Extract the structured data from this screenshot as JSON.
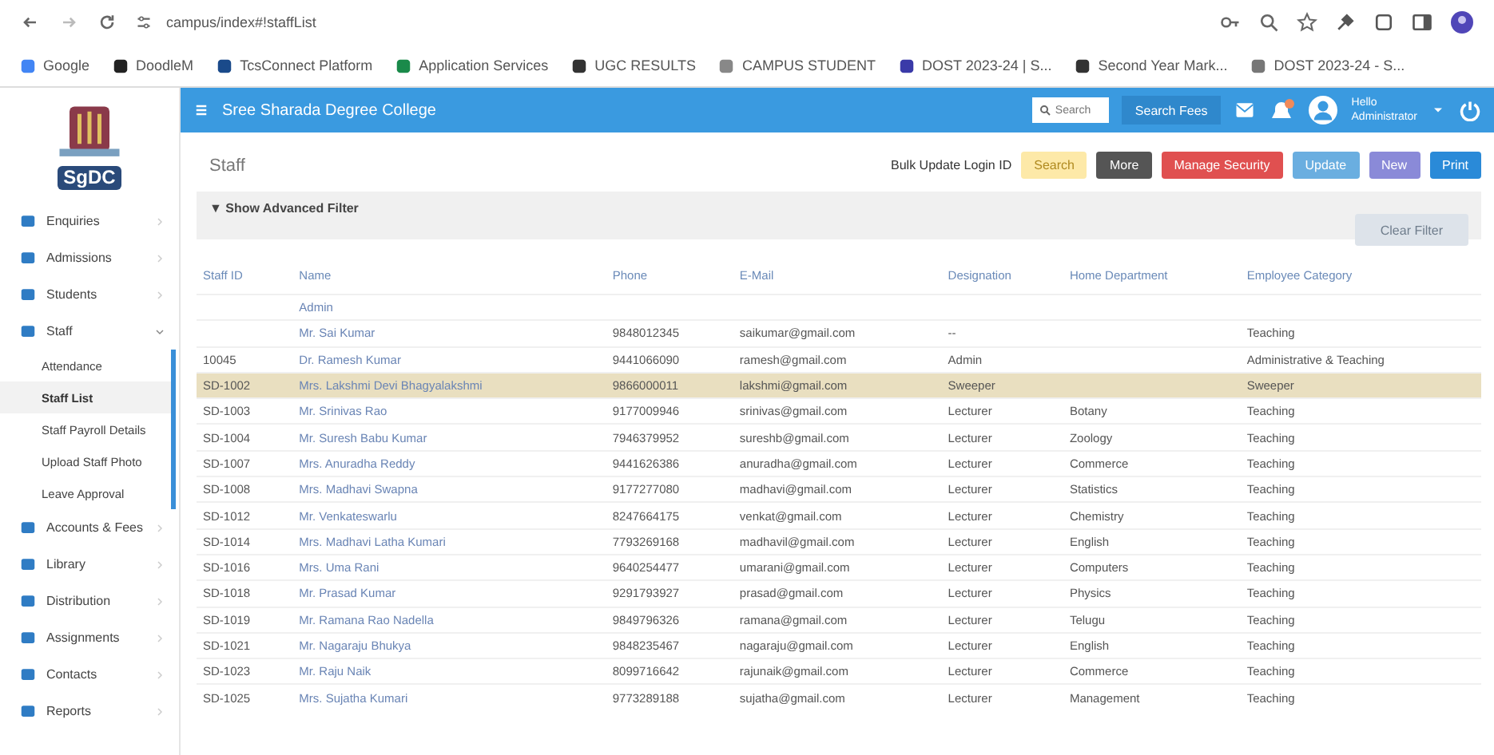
{
  "browser": {
    "url": "campus/index#!staffList",
    "bookmarks": [
      {
        "label": "Google"
      },
      {
        "label": "DoodleM"
      },
      {
        "label": "TcsConnect Platform"
      },
      {
        "label": "Application Services"
      },
      {
        "label": "UGC RESULTS"
      },
      {
        "label": "CAMPUS STUDENT"
      },
      {
        "label": "DOST 2023-24 | S..."
      },
      {
        "label": "Second Year Mark..."
      },
      {
        "label": "DOST 2023-24 - S..."
      }
    ]
  },
  "sidebar": {
    "logo_text": "SgDC",
    "items": [
      {
        "label": "Enquiries",
        "expanded": false,
        "selected": false
      },
      {
        "label": "Admissions",
        "expanded": false,
        "selected": false
      },
      {
        "label": "Students",
        "expanded": false,
        "selected": false
      },
      {
        "label": "Staff",
        "expanded": true,
        "selected": false,
        "children": [
          {
            "label": "Attendance",
            "selected": false
          },
          {
            "label": "Staff List",
            "selected": true
          },
          {
            "label": "Staff Payroll Details",
            "selected": false
          },
          {
            "label": "Upload Staff Photo",
            "selected": false
          },
          {
            "label": "Leave Approval",
            "selected": false
          }
        ]
      },
      {
        "label": "Accounts & Fees",
        "expanded": false,
        "selected": false
      },
      {
        "label": "Library",
        "expanded": false,
        "selected": false
      },
      {
        "label": "Distribution",
        "expanded": false,
        "selected": false
      },
      {
        "label": "Assignments",
        "expanded": false,
        "selected": false
      },
      {
        "label": "Contacts",
        "expanded": false,
        "selected": false
      },
      {
        "label": "Reports",
        "expanded": false,
        "selected": false
      }
    ]
  },
  "header": {
    "title": "Sree Sharada Degree College",
    "search_placeholder": "Search",
    "search_fees": "Search Fees",
    "user_greeting": "Hello",
    "user_name": "Administrator"
  },
  "page": {
    "title": "Staff",
    "bulk_label": "Bulk Update Login ID",
    "buttons": [
      {
        "label": "Search",
        "kind": "warning"
      },
      {
        "label": "More",
        "kind": "dark"
      },
      {
        "label": "Manage Security",
        "kind": "danger"
      },
      {
        "label": "Update",
        "kind": "info"
      },
      {
        "label": "New",
        "kind": "purple"
      },
      {
        "label": "Print",
        "kind": "primary"
      }
    ],
    "filter_label": "▼ Show Advanced Filter",
    "filter_button": {
      "label": "Clear Filter",
      "disabled": true
    }
  },
  "table": {
    "columns": [
      "Staff ID",
      "Name",
      "Phone",
      "E-Mail",
      "Designation",
      "Home Department",
      "Employee Category"
    ],
    "rows": [
      {
        "selected": false,
        "cells": [
          "",
          "Admin",
          "",
          "",
          "",
          "",
          ""
        ]
      },
      {
        "selected": false,
        "cells": [
          "",
          "Mr. Sai Kumar",
          "9848012345",
          "saikumar@gmail.com",
          "--",
          "",
          "Teaching"
        ]
      },
      {
        "selected": false,
        "cells": [
          "10045",
          "Dr. Ramesh Kumar",
          "9441066090",
          "ramesh@gmail.com",
          "Admin",
          "",
          "Administrative & Teaching"
        ]
      },
      {
        "selected": true,
        "cells": [
          "SD-1002",
          "Mrs. Lakshmi Devi Bhagyalakshmi",
          "9866000011",
          "lakshmi@gmail.com",
          "Sweeper",
          "",
          "Sweeper"
        ]
      },
      {
        "selected": false,
        "cells": [
          "SD-1003",
          "Mr. Srinivas Rao",
          "9177009946",
          "srinivas@gmail.com",
          "Lecturer",
          "Botany",
          "Teaching"
        ]
      },
      {
        "selected": false,
        "cells": [
          "SD-1004",
          "Mr. Suresh Babu Kumar",
          "7946379952",
          "sureshb@gmail.com",
          "Lecturer",
          "Zoology",
          "Teaching"
        ]
      },
      {
        "selected": false,
        "cells": [
          "SD-1007",
          "Mrs. Anuradha Reddy",
          "9441626386",
          "anuradha@gmail.com",
          "Lecturer",
          "Commerce",
          "Teaching"
        ]
      },
      {
        "selected": false,
        "cells": [
          "SD-1008",
          "Mrs. Madhavi Swapna",
          "9177277080",
          "madhavi@gmail.com",
          "Lecturer",
          "Statistics",
          "Teaching"
        ]
      },
      {
        "selected": false,
        "cells": [
          "SD-1012",
          "Mr. Venkateswarlu",
          "8247664175",
          "venkat@gmail.com",
          "Lecturer",
          "Chemistry",
          "Teaching"
        ]
      },
      {
        "selected": false,
        "cells": [
          "SD-1014",
          "Mrs. Madhavi Latha Kumari",
          "7793269168",
          "madhavil@gmail.com",
          "Lecturer",
          "English",
          "Teaching"
        ]
      },
      {
        "selected": false,
        "cells": [
          "SD-1016",
          "Mrs. Uma Rani",
          "9640254477",
          "umarani@gmail.com",
          "Lecturer",
          "Computers",
          "Teaching"
        ]
      },
      {
        "selected": false,
        "cells": [
          "SD-1018",
          "Mr. Prasad Kumar",
          "9291793927",
          "prasad@gmail.com",
          "Lecturer",
          "Physics",
          "Teaching"
        ]
      },
      {
        "selected": false,
        "cells": [
          "SD-1019",
          "Mr. Ramana Rao Nadella",
          "9849796326",
          "ramana@gmail.com",
          "Lecturer",
          "Telugu",
          "Teaching"
        ]
      },
      {
        "selected": false,
        "cells": [
          "SD-1021",
          "Mr. Nagaraju Bhukya",
          "9848235467",
          "nagaraju@gmail.com",
          "Lecturer",
          "English",
          "Teaching"
        ]
      },
      {
        "selected": false,
        "cells": [
          "SD-1023",
          "Mr. Raju Naik",
          "8099716642",
          "rajunaik@gmail.com",
          "Lecturer",
          "Commerce",
          "Teaching"
        ]
      },
      {
        "selected": false,
        "cells": [
          "SD-1025",
          "Mrs. Sujatha Kumari",
          "9773289188",
          "sujatha@gmail.com",
          "Lecturer",
          "Management",
          "Teaching"
        ]
      }
    ]
  }
}
